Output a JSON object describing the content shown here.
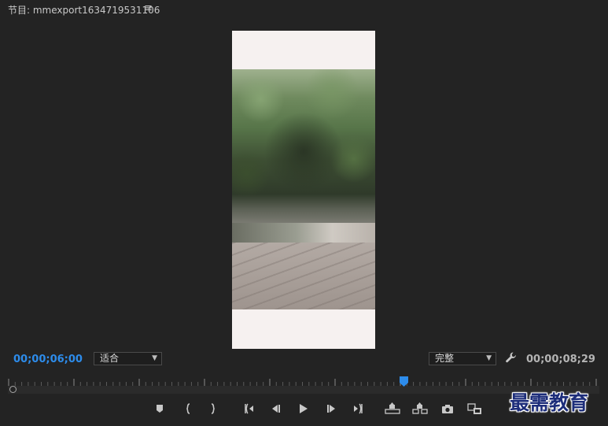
{
  "panel": {
    "title": "节目: mmexport1634719531106",
    "menu_icon": "hamburger-menu-icon"
  },
  "controls": {
    "current_timecode": "00;00;06;00",
    "zoom_select": {
      "selected": "适合"
    },
    "quality_select": {
      "selected": "完整"
    },
    "settings_icon": "wrench-icon",
    "duration_timecode": "00;00;08;29"
  },
  "transport": {
    "buttons": [
      "add-marker-icon",
      "mark-in-icon",
      "mark-out-icon",
      "go-to-in-icon",
      "step-back-icon",
      "play-icon",
      "step-forward-icon",
      "go-to-out-icon",
      "lift-icon",
      "extract-icon",
      "export-frame-icon",
      "compare-view-icon"
    ]
  },
  "playhead_fraction": 0.67,
  "watermark": "最需教育",
  "colors": {
    "accent_timecode": "#2d8ceb",
    "background": "#232323",
    "playhead": "#2d8ceb"
  }
}
